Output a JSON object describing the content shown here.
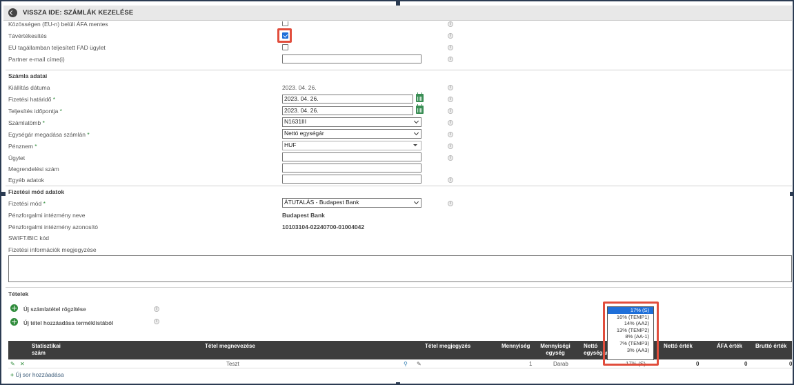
{
  "title": "VISSZA IDE: SZÁMLÁK KEZELÉSE",
  "top_rows": {
    "eu_label": "Közösségen (EU-n) belüli ÁFA mentes",
    "tavertekesites": "Távértékesítés",
    "eu_fad": "EU tagállamban teljesített FAD ügylet",
    "partner_email": "Partner e-mail címe(i)"
  },
  "szamla": {
    "section": "Számla adatai",
    "kiallitas_label": "Kiállítás dátuma",
    "kiallitas_value": "2023. 04. 26.",
    "fizetesi_hatarido_label": "Fizetési határidő",
    "fizetesi_hatarido_value": "2023. 04. 26.",
    "teljesites_label": "Teljesítés időpontja",
    "teljesites_value": "2023. 04. 26.",
    "szamlatomb_label": "Számlatömb",
    "szamlatomb_value": "N1631III",
    "egysegar_label": "Egységár megadása számlán",
    "egysegar_value": "Nettó egységár",
    "penznem_label": "Pénznem",
    "penznem_value": "HUF",
    "ugylet_label": "Ügylet",
    "megrendelesi_label": "Megrendelési szám",
    "egyeb_label": "Egyéb adatok",
    "required_mark": "*"
  },
  "fizetes": {
    "section": "Fizetési mód adatok",
    "mod_label": "Fizetési mód",
    "mod_value": "ÁTUTALÁS - Budapest Bank",
    "intezmeny_nev_label": "Pénzforgalmi intézmény neve",
    "intezmeny_nev_value": "Budapest Bank",
    "intezmeny_azon_label": "Pénzforgalmi intézmény azonosító",
    "intezmeny_azon_value": "10103104-02240700-01004042",
    "swift_label": "SWIFT/BIC kód",
    "megjegyzes_label": "Fizetési információk megjegyzése"
  },
  "tetelek": {
    "section": "Tételek",
    "uj_rogzites": "Új számlatétel rögzítése",
    "uj_termeklista": "Új tétel hozzáadása terméklistából",
    "uj_sor": "Új sor hozzáadása"
  },
  "table": {
    "headers": {
      "stat": "Statisztikai szám",
      "megnevezes": "Tétel megnevezése",
      "megjegyzes": "Tétel megjegyzés",
      "mennyiseg": "Mennyiség",
      "mennyisegi_egyseg": "Mennyiségi egység",
      "netto_egysegar": "Nettó egységár",
      "netto_ertek": "Nettó érték",
      "afa_ertek": "ÁFA érték",
      "brutto_ertek": "Bruttó érték"
    },
    "row": {
      "megnevezes": "Teszt",
      "mennyiseg": "1",
      "egyseg": "Darab",
      "afa_partial": "17% (S)",
      "netto": "0",
      "afa": "0",
      "brutto": "0"
    }
  },
  "vat_dropdown": {
    "options": [
      "17% (S)",
      "16% (TEMP1)",
      "14% (AA2)",
      "13% (TEMP2)",
      "8% (AA-1)",
      "7% (TEMP3)",
      "3% (AA3)"
    ],
    "selected_index": 0
  },
  "colors": {
    "accent": "#1e6fd9",
    "highlight": "#e14d3c",
    "green": "#2e8b3a",
    "header_dark": "#3d3d3d"
  },
  "icons": {
    "info": "i"
  }
}
